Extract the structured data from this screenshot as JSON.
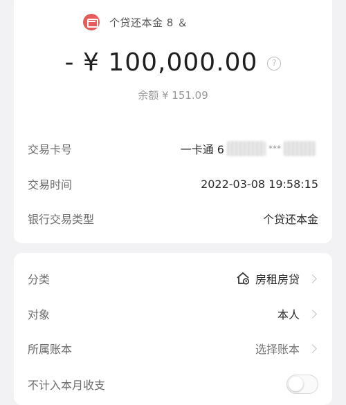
{
  "merchant": {
    "icon": "card-icon",
    "text": "个贷还本金 8 ＆"
  },
  "amount": {
    "text": "- ¥ 100,000.00",
    "help_icon": "question-icon"
  },
  "balance": {
    "text": "余额 ¥ 151.09"
  },
  "details": {
    "card": {
      "label": "交易卡号",
      "prefix": "一卡通 6",
      "masked": "***"
    },
    "time": {
      "label": "交易时间",
      "value": "2022-03-08 19:58:15"
    },
    "type": {
      "label": "银行交易类型",
      "value": "个贷还本金"
    }
  },
  "settings": {
    "category": {
      "label": "分类",
      "value": "房租房贷",
      "icon": "house-icon"
    },
    "target": {
      "label": "对象",
      "value": "本人"
    },
    "ledger": {
      "label": "所属账本",
      "value": "选择账本"
    },
    "exclude": {
      "label": "不计入本月收支",
      "toggle_on": false
    }
  },
  "colors": {
    "accent_red": "#e65b5b",
    "background": "#f2f2f4"
  }
}
